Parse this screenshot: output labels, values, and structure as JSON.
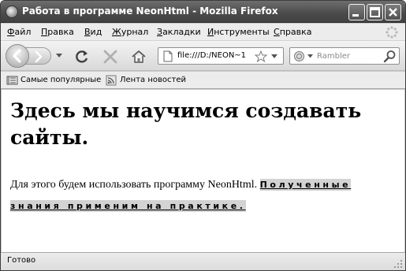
{
  "window": {
    "title": "Работа в программе NeonHtml - Mozilla Firefox"
  },
  "menu": {
    "items": [
      {
        "first": "Ф",
        "rest": "айл"
      },
      {
        "first": "П",
        "rest": "равка"
      },
      {
        "first": "В",
        "rest": "ид"
      },
      {
        "first": "Ж",
        "rest": "урнал"
      },
      {
        "first": "З",
        "rest": "акладки"
      },
      {
        "first": "И",
        "rest": "нструменты"
      },
      {
        "first": "С",
        "rest": "правка"
      }
    ]
  },
  "navbar": {
    "url": "file:///D:/NEON~1",
    "search_placeholder": "Rambler"
  },
  "bookmarks": {
    "items": [
      "Самые популярные",
      "Лента новостей"
    ]
  },
  "page": {
    "heading": "Здесь мы научимся создавать сайты.",
    "text": "Для этого будем использовать программу NeonHtml. ",
    "highlight": "Полученные знания применим на практике."
  },
  "status": {
    "text": "Готово"
  },
  "colors": {
    "titlebar": "#4a4a4a",
    "highlight_bg": "#d3d3d3"
  }
}
